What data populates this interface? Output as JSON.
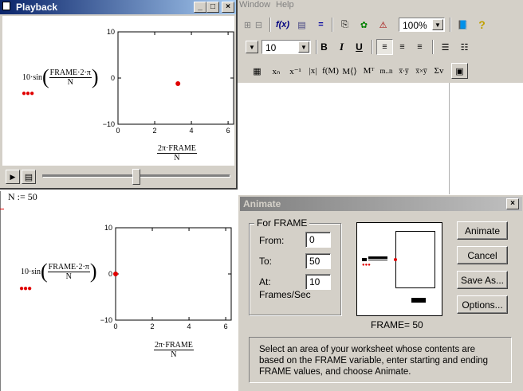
{
  "app": {
    "menu_items": [
      "Window",
      "Help"
    ],
    "zoom_value": "100%",
    "font_size_value": "10",
    "toolbar_bold": "B",
    "toolbar_italic": "I",
    "toolbar_underline": "U",
    "math_toolbar": [
      "xₙ",
      "x⁻¹",
      "|x|",
      "f(M)",
      "M⟨⟩",
      "Mᵀ",
      "m..n",
      "x̅·y̅",
      "x̅×y̅",
      "Σv"
    ]
  },
  "playback": {
    "title": "Playback",
    "min_label": "_",
    "max_label": "□",
    "close_label": "×",
    "play_label": "▶",
    "slider_position": 0.5,
    "plot": {
      "y_ticks": [
        "10",
        "0",
        "−10"
      ],
      "x_ticks": [
        "0",
        "2",
        "4",
        "6"
      ],
      "ylabel_coef": "10·sin",
      "ylabel_num": "FRAME·2·π",
      "ylabel_den": "N",
      "xlabel_num": "2π·FRAME",
      "xlabel_den": "N",
      "legend_marker": "●●●"
    }
  },
  "worksheet": {
    "definition": "N := 50",
    "plot": {
      "y_ticks": [
        "10",
        "0",
        "−10"
      ],
      "x_ticks": [
        "0",
        "2",
        "4",
        "6"
      ],
      "ylabel_coef": "10·sin",
      "ylabel_num": "FRAME·2·π",
      "ylabel_den": "N",
      "xlabel_num": "2π·FRAME",
      "xlabel_den": "N",
      "legend_marker": "●●●"
    }
  },
  "animate": {
    "title": "Animate",
    "close_label": "×",
    "group_label": "For FRAME",
    "from_label": "From:",
    "from_value": "0",
    "to_label": "To:",
    "to_value": "50",
    "at_label": "At:",
    "at_value": "10",
    "rate_label": "Frames/Sec",
    "frame_readout": "FRAME=  50",
    "buttons": {
      "animate": "Animate",
      "cancel": "Cancel",
      "save_as": "Save As...",
      "options": "Options..."
    },
    "help_text": "Select an area of your worksheet whose contents are based on the FRAME variable, enter starting and ending FRAME values, and choose Animate."
  },
  "chart_data": [
    {
      "type": "scatter",
      "x": [
        3.267
      ],
      "y": [
        -1.2
      ],
      "xlim": [
        0,
        6.3
      ],
      "ylim": [
        -10,
        10
      ],
      "point_color": "#e00000"
    },
    {
      "type": "scatter",
      "x": [
        0
      ],
      "y": [
        0
      ],
      "xlim": [
        0,
        6.3
      ],
      "ylim": [
        -10,
        10
      ],
      "point_color": "#e00000"
    }
  ]
}
